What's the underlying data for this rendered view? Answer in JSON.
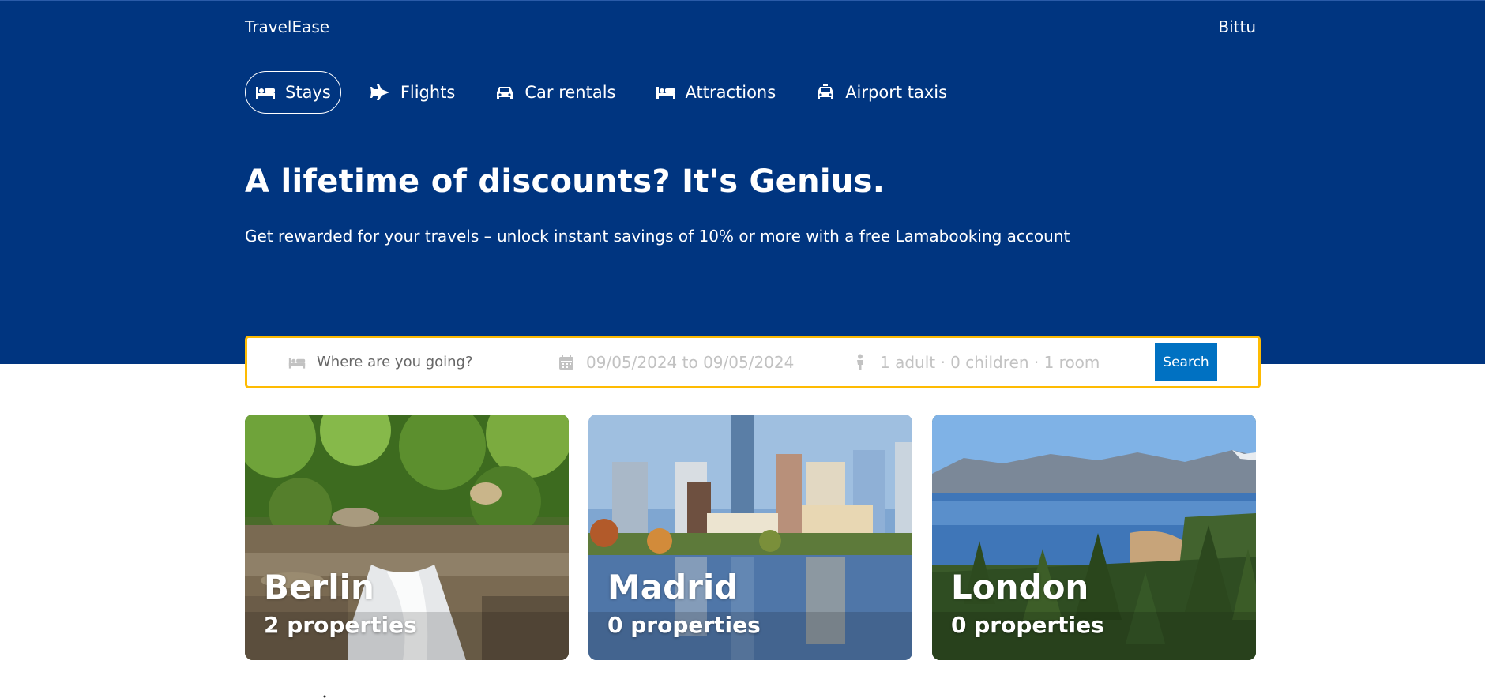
{
  "header": {
    "brand": "TravelEase",
    "user": "Bittu"
  },
  "nav": {
    "items": [
      {
        "label": "Stays",
        "icon": "bed-icon",
        "active": true
      },
      {
        "label": "Flights",
        "icon": "plane-icon",
        "active": false
      },
      {
        "label": "Car rentals",
        "icon": "car-icon",
        "active": false
      },
      {
        "label": "Attractions",
        "icon": "bed-icon",
        "active": false
      },
      {
        "label": "Airport taxis",
        "icon": "taxi-icon",
        "active": false
      }
    ]
  },
  "hero": {
    "title": "A lifetime of discounts? It's Genius.",
    "subtitle": "Get rewarded for your travels – unlock instant savings of 10% or more with a free Lamabooking account"
  },
  "search": {
    "destination_placeholder": "Where are you going?",
    "dates": "09/05/2024 to 09/05/2024",
    "guests": "1 adult · 0 children · 1 room",
    "button": "Search"
  },
  "featured": [
    {
      "city": "Berlin",
      "properties": "2 properties"
    },
    {
      "city": "Madrid",
      "properties": "0 properties"
    },
    {
      "city": "London",
      "properties": "0 properties"
    }
  ],
  "colors": {
    "hero_bg": "#003580",
    "search_border": "#febb02",
    "search_button": "#0071c2"
  }
}
